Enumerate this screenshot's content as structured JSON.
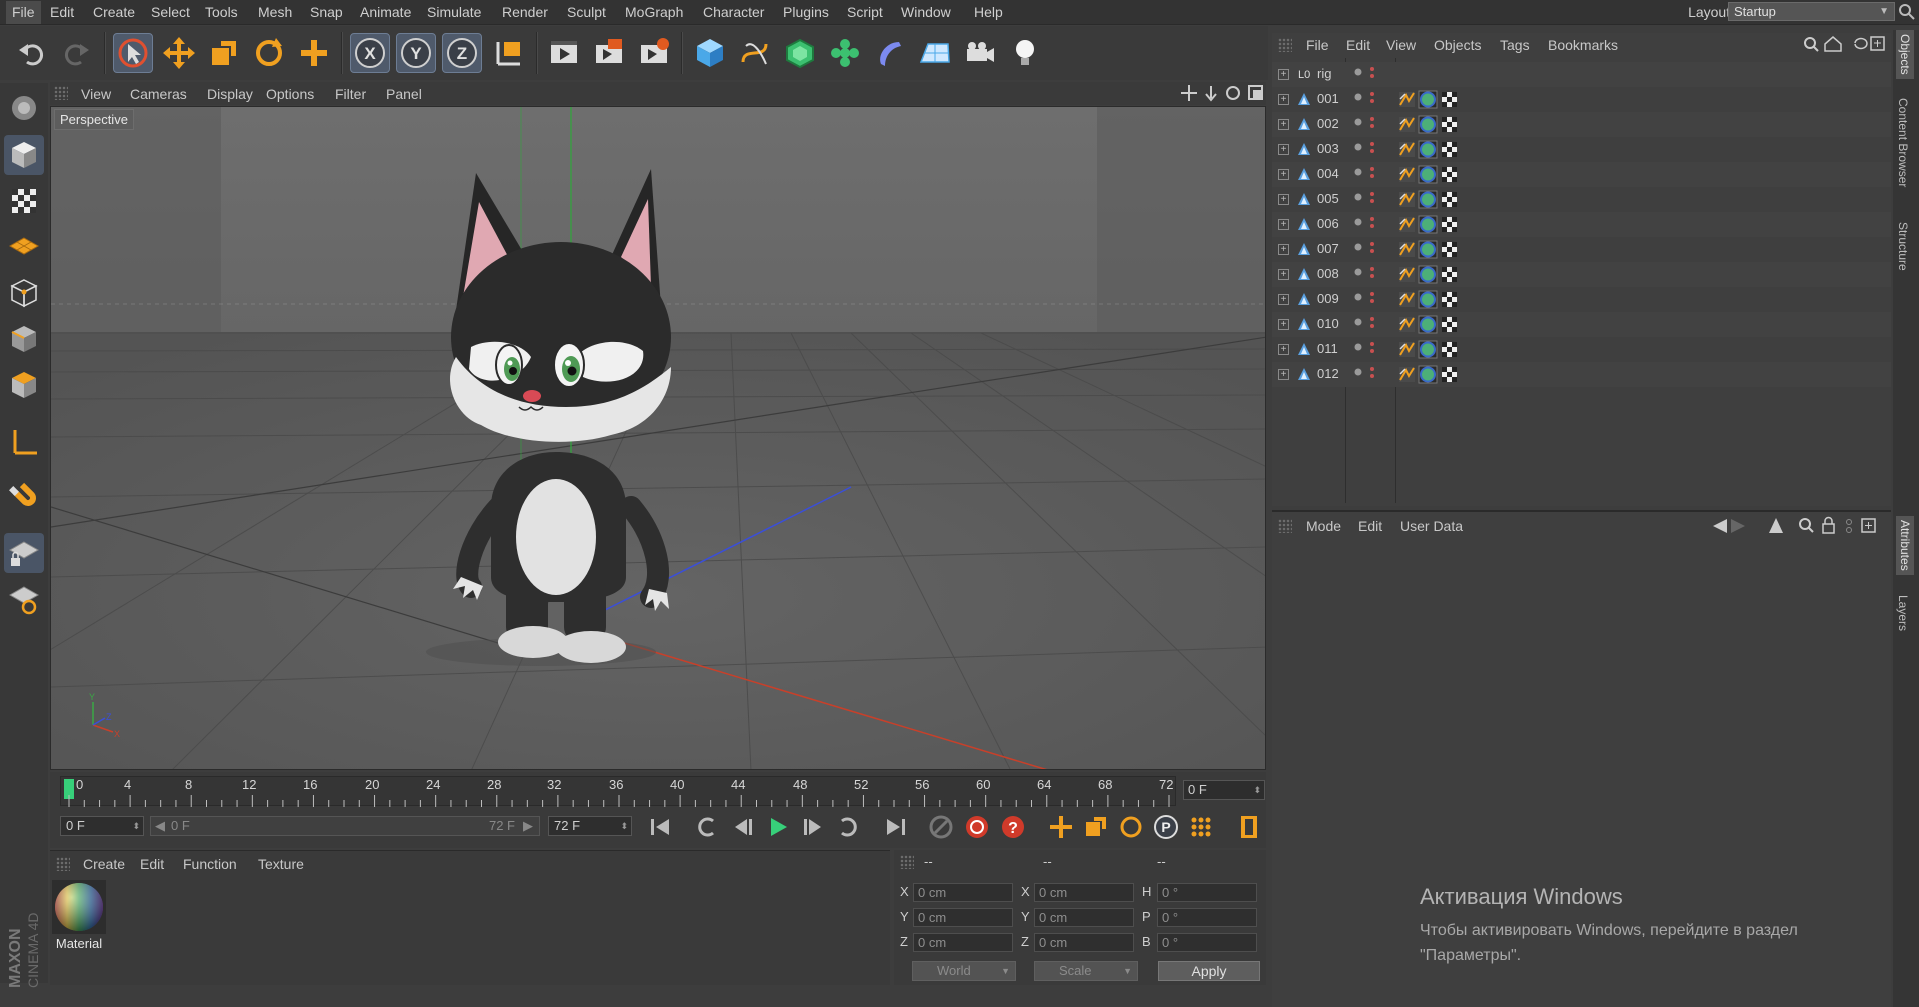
{
  "menubar": {
    "items": [
      "File",
      "Edit",
      "Create",
      "Select",
      "Tools",
      "Mesh",
      "Snap",
      "Animate",
      "Simulate",
      "Render",
      "Sculpt",
      "MoGraph",
      "Character",
      "Plugins",
      "Script",
      "Window",
      "Help"
    ],
    "layout_label": "Layout:",
    "layout_value": "Startup"
  },
  "toolbar": {
    "icons": [
      "undo-icon",
      "redo-icon",
      "live-select-icon",
      "move-icon",
      "scale-icon",
      "rotate-icon",
      "add-icon",
      "x-axis-icon",
      "y-axis-icon",
      "z-axis-icon",
      "coordinate-system-icon",
      "render-view-icon",
      "render-picture-viewer-icon",
      "render-settings-icon",
      "cube-icon",
      "spline-pen-icon",
      "subdivision-surface-icon",
      "cloner-icon",
      "deformer-icon",
      "floor-icon",
      "camera-icon",
      "light-icon"
    ]
  },
  "left_tools": {
    "icons": [
      "make-editable-icon",
      "model-mode-icon",
      "texture-mode-icon",
      "workplane-icon",
      "points-mode-icon",
      "edges-mode-icon",
      "polygons-mode-icon",
      "axis-mode-icon",
      "snap-magnet-icon",
      "locked-workplane-icon",
      "planar-workplane-icon"
    ]
  },
  "viewport": {
    "menu": [
      "View",
      "Cameras",
      "Display",
      "Options",
      "Filter",
      "Panel"
    ],
    "label": "Perspective"
  },
  "timeline": {
    "ticks": [
      "0",
      "4",
      "8",
      "12",
      "16",
      "20",
      "24",
      "28",
      "32",
      "36",
      "40",
      "44",
      "48",
      "52",
      "56",
      "60",
      "64",
      "68",
      "72"
    ],
    "current_frame": "0 F",
    "start_field": "0 F",
    "range_start": "0 F",
    "range_end": "72 F",
    "end_field": "72 F"
  },
  "material_manager": {
    "menu": [
      "Create",
      "Edit",
      "Function",
      "Texture"
    ],
    "material_name": "Material"
  },
  "coordinates": {
    "header": [
      "--",
      "--",
      "--"
    ],
    "rows": [
      {
        "a": "X",
        "av": "0 cm",
        "b": "X",
        "bv": "0 cm",
        "c": "H",
        "cv": "0 °"
      },
      {
        "a": "Y",
        "av": "0 cm",
        "b": "Y",
        "bv": "0 cm",
        "c": "P",
        "cv": "0 °"
      },
      {
        "a": "Z",
        "av": "0 cm",
        "b": "Z",
        "bv": "0 cm",
        "c": "B",
        "cv": "0 °"
      }
    ],
    "space": "World",
    "mode": "Scale",
    "apply": "Apply"
  },
  "object_manager": {
    "menu": [
      "File",
      "Edit",
      "View",
      "Objects",
      "Tags",
      "Bookmarks"
    ],
    "objects": [
      {
        "name": "rig",
        "type": "null"
      },
      {
        "name": "001",
        "type": "polygon"
      },
      {
        "name": "002",
        "type": "polygon"
      },
      {
        "name": "003",
        "type": "polygon"
      },
      {
        "name": "004",
        "type": "polygon"
      },
      {
        "name": "005",
        "type": "polygon"
      },
      {
        "name": "006",
        "type": "polygon"
      },
      {
        "name": "007",
        "type": "polygon"
      },
      {
        "name": "008",
        "type": "polygon"
      },
      {
        "name": "009",
        "type": "polygon"
      },
      {
        "name": "010",
        "type": "polygon"
      },
      {
        "name": "011",
        "type": "polygon"
      },
      {
        "name": "012",
        "type": "polygon"
      }
    ]
  },
  "attribute_manager": {
    "menu": [
      "Mode",
      "Edit",
      "User Data"
    ]
  },
  "side_tabs": [
    "Objects",
    "Content Browser",
    "Structure",
    "Attributes",
    "Layers"
  ],
  "watermark": {
    "title": "Активация Windows",
    "subtitle": "Чтобы активировать Windows, перейдите в раздел \"Параметры\"."
  },
  "colors": {
    "accent_orange": "#f0a020",
    "accent_blue": "#5aa0e0",
    "timeline_green": "#37d07a",
    "axis_red": "#d03a2a",
    "axis_green": "#2fa83a",
    "axis_blue": "#3b4fd8"
  }
}
